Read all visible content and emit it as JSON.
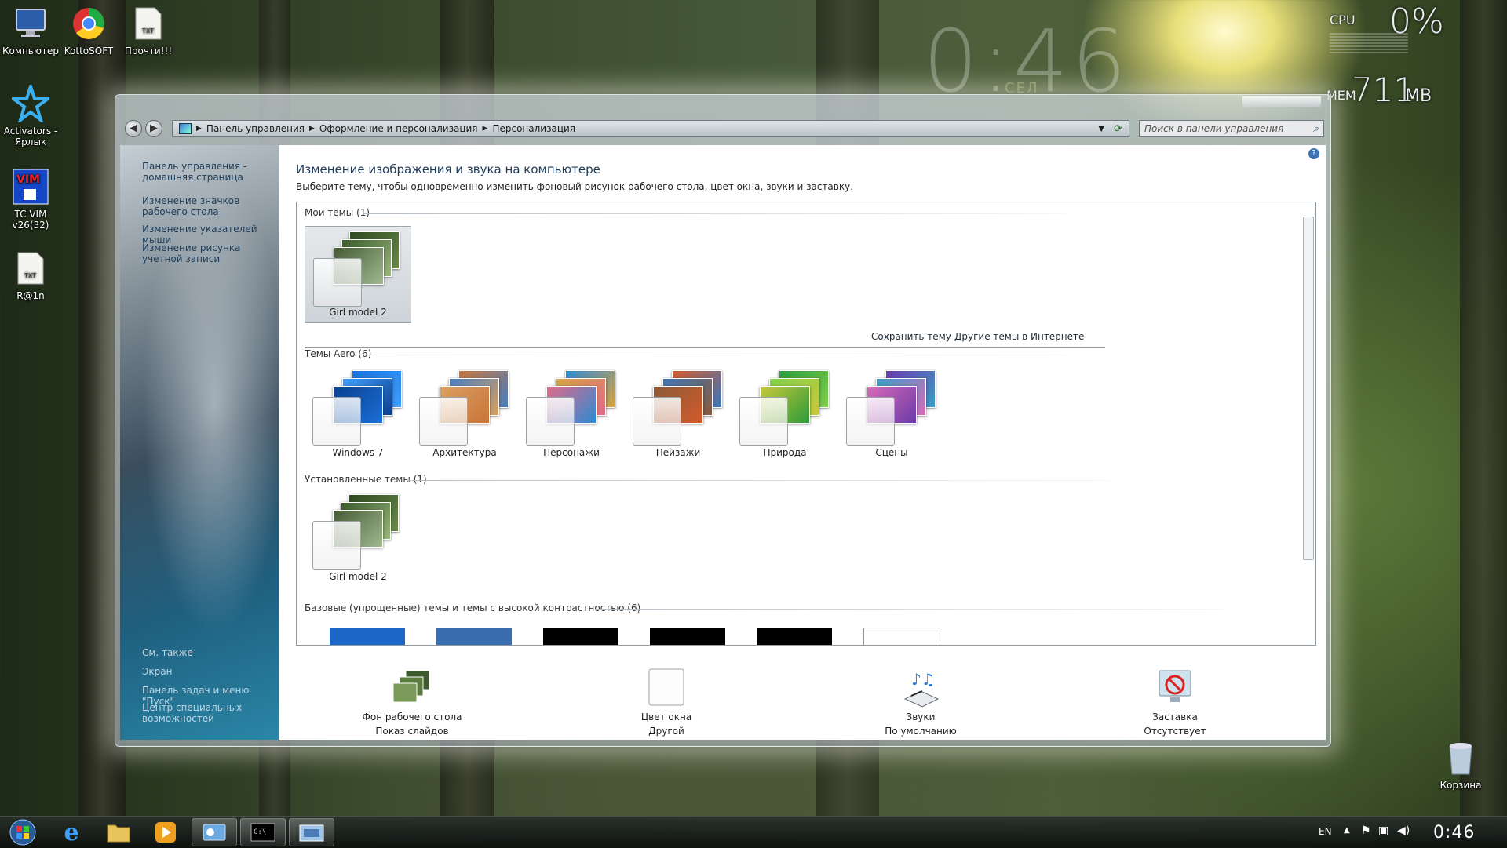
{
  "desktop": {
    "icons": [
      {
        "label": "Компьютер",
        "icon": "computer-icon"
      },
      {
        "label": "KottoSOFT",
        "icon": "kottosoft-icon"
      },
      {
        "label": "Прочти!!!",
        "icon": "text-file-icon"
      },
      {
        "label": "Activators - Ярлык",
        "icon": "activators-icon"
      },
      {
        "label": "TC VIM v26(32)",
        "icon": "tc-vim-icon"
      },
      {
        "label": "R@1n",
        "icon": "text-file-icon"
      },
      {
        "label": "Корзина",
        "icon": "recycle-bin-icon"
      }
    ],
    "gadgets": {
      "clock": "0:46",
      "clock_sub": "СЕЛ",
      "cpu_label": "CPU",
      "cpu_value": "0%",
      "mem_label": "MEM",
      "mem_value": "711",
      "mem_unit": "MB"
    }
  },
  "window": {
    "address": {
      "crumbs": [
        "Панель управления",
        "Оформление и персонализация",
        "Персонализация"
      ]
    },
    "search": {
      "placeholder": "Поиск в панели управления"
    },
    "sidebar": {
      "links": [
        "Панель управления - домашняя страница",
        "Изменение значков рабочего стола",
        "Изменение указателей мыши",
        "Изменение рисунка учетной записи"
      ],
      "see_also_title": "См. также",
      "see_also": [
        "Экран",
        "Панель задач и меню \"Пуск\"",
        "Центр специальных возможностей"
      ]
    },
    "title": "Изменение изображения и звука на компьютере",
    "description": "Выберите тему, чтобы одновременно изменить фоновый рисунок рабочего стола, цвет окна, звуки и заставку.",
    "groups": {
      "my_themes": {
        "title": "Мои темы (1)",
        "items": [
          {
            "name": "Girl model 2",
            "selected": true
          }
        ]
      },
      "actions": {
        "save": "Сохранить тему",
        "online": "Другие темы в Интернете"
      },
      "aero": {
        "title": "Темы Aero (6)",
        "items": [
          {
            "name": "Windows 7",
            "colors": [
              "#1a6fd6",
              "#3fa0ff",
              "#0b3f8f"
            ]
          },
          {
            "name": "Архитектура",
            "colors": [
              "#c9743a",
              "#4a7fc0",
              "#d9a060"
            ]
          },
          {
            "name": "Персонажи",
            "colors": [
              "#2d8bd4",
              "#d8a23e",
              "#e06a8a"
            ]
          },
          {
            "name": "Пейзажи",
            "colors": [
              "#d35a2a",
              "#3f76b8",
              "#8a5b3a"
            ]
          },
          {
            "name": "Природа",
            "colors": [
              "#2c9a3a",
              "#7fd04a",
              "#c9c93a"
            ]
          },
          {
            "name": "Сцены",
            "colors": [
              "#6a3aa8",
              "#3aa0c8",
              "#d86ab8"
            ]
          }
        ]
      },
      "installed": {
        "title": "Установленные темы (1)",
        "items": [
          {
            "name": "Girl model 2"
          }
        ]
      },
      "basic": {
        "title": "Базовые (упрощенные) темы и темы с высокой контрастностью (6)",
        "swatches": [
          "#1c66c8",
          "#3a6db0",
          "#000000",
          "#000000",
          "#000000",
          "#ffffff"
        ]
      }
    },
    "bottom": [
      {
        "title": "Фон рабочего стола",
        "value": "Показ слайдов"
      },
      {
        "title": "Цвет окна",
        "value": "Другой"
      },
      {
        "title": "Звуки",
        "value": "По умолчанию"
      },
      {
        "title": "Заставка",
        "value": "Отсутствует"
      }
    ]
  },
  "taskbar": {
    "language": "EN",
    "clock": "0:46"
  },
  "colors": {
    "accent": "#1e3b5a",
    "link": "#203f5a"
  }
}
